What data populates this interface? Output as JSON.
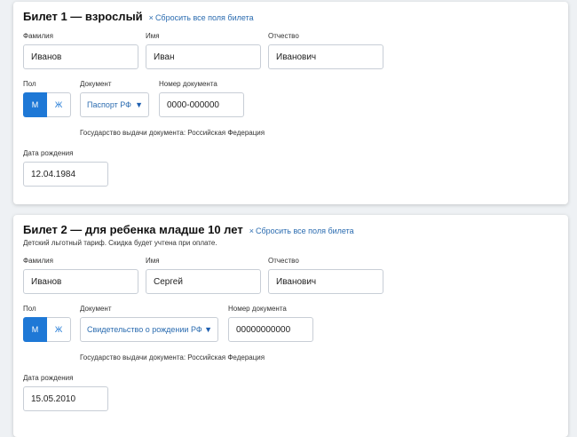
{
  "tickets": [
    {
      "title": "Билет 1 — взрослый",
      "reset_label": "Сбросить все поля билета",
      "note": "",
      "lastname_label": "Фамилия",
      "lastname_value": "Иванов",
      "firstname_label": "Имя",
      "firstname_value": "Иван",
      "patronymic_label": "Отчество",
      "patronymic_value": "Иванович",
      "gender_label": "Пол",
      "gender_male": "М",
      "gender_female": "Ж",
      "document_label": "Документ",
      "document_value": "Паспорт РФ",
      "docnum_label": "Номер документа",
      "docnum_value": "0000-000000",
      "issuer_text": "Государство выдачи документа: Российская Федерация",
      "birth_label": "Дата рождения",
      "birth_value": "12.04.1984"
    },
    {
      "title": "Билет 2 — для ребенка младше 10 лет",
      "reset_label": "Сбросить все поля билета",
      "note": "Детский льготный тариф. Скидка будет учтена при оплате.",
      "lastname_label": "Фамилия",
      "lastname_value": "Иванов",
      "firstname_label": "Имя",
      "firstname_value": "Сергей",
      "patronymic_label": "Отчество",
      "patronymic_value": "Иванович",
      "gender_label": "Пол",
      "gender_male": "М",
      "gender_female": "Ж",
      "document_label": "Документ",
      "document_value": "Свидетельство о рождении РФ",
      "docnum_label": "Номер документа",
      "docnum_value": "00000000000",
      "issuer_text": "Государство выдачи документа: Российская Федерация",
      "birth_label": "Дата рождения",
      "birth_value": "15.05.2010"
    }
  ],
  "colors": {
    "accent": "#1e78d6",
    "link": "#2b6cb0",
    "border": "#c8ced6"
  }
}
